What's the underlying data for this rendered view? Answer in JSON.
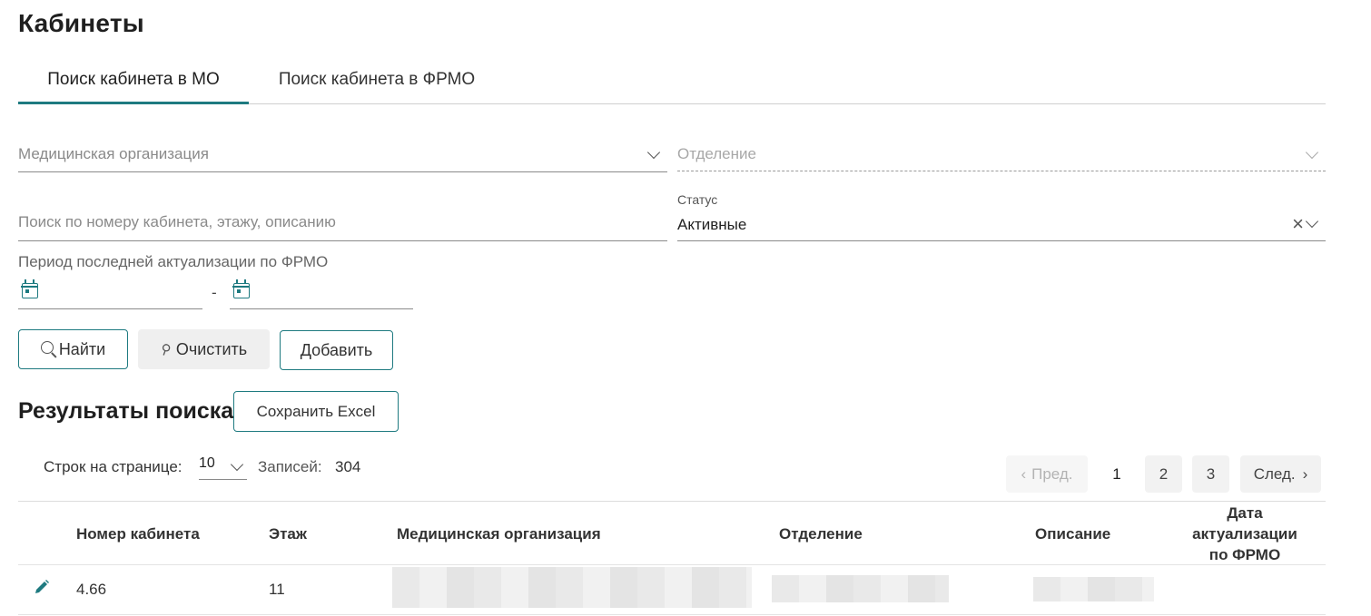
{
  "page": {
    "title": "Кабинеты"
  },
  "tabs": [
    {
      "label": "Поиск кабинета в МО",
      "active": true
    },
    {
      "label": "Поиск кабинета в ФРМО",
      "active": false
    }
  ],
  "filters": {
    "organization": {
      "placeholder": "Медицинская организация"
    },
    "department": {
      "placeholder": "Отделение"
    },
    "search": {
      "placeholder": "Поиск по номеру кабинета, этажу, описанию"
    },
    "status": {
      "label": "Статус",
      "value": "Активные"
    },
    "period": {
      "label": "Период последней актуализации по ФРМО",
      "separator": "-"
    }
  },
  "actions": {
    "find": "Найти",
    "clear": "Очистить",
    "add": "Добавить"
  },
  "results": {
    "title": "Результаты поиска",
    "export_label": "Сохранить Excel",
    "rows_per_page_label": "Строк на странице:",
    "rows_per_page_value": "10",
    "records_label": "Записей:",
    "records_count": "304"
  },
  "pagination": {
    "prev": "Пред.",
    "next": "След.",
    "pages": [
      "1",
      "2",
      "3"
    ],
    "current": "1"
  },
  "table": {
    "columns": {
      "number": "Номер кабинета",
      "floor": "Этаж",
      "organization": "Медицинская организация",
      "department": "Отделение",
      "description": "Описание",
      "actualization_line1": "Дата",
      "actualization_line2": "актуализации",
      "actualization_line3": "по ФРМО"
    },
    "rows": [
      {
        "number": "4.66",
        "floor": "11"
      }
    ]
  },
  "colors": {
    "accent": "#1e7a80"
  },
  "icons": [
    "chevron-down-icon",
    "close-icon",
    "calendar-icon",
    "search-icon",
    "broom-icon",
    "chevron-left-icon",
    "chevron-right-icon",
    "pencil-icon"
  ]
}
